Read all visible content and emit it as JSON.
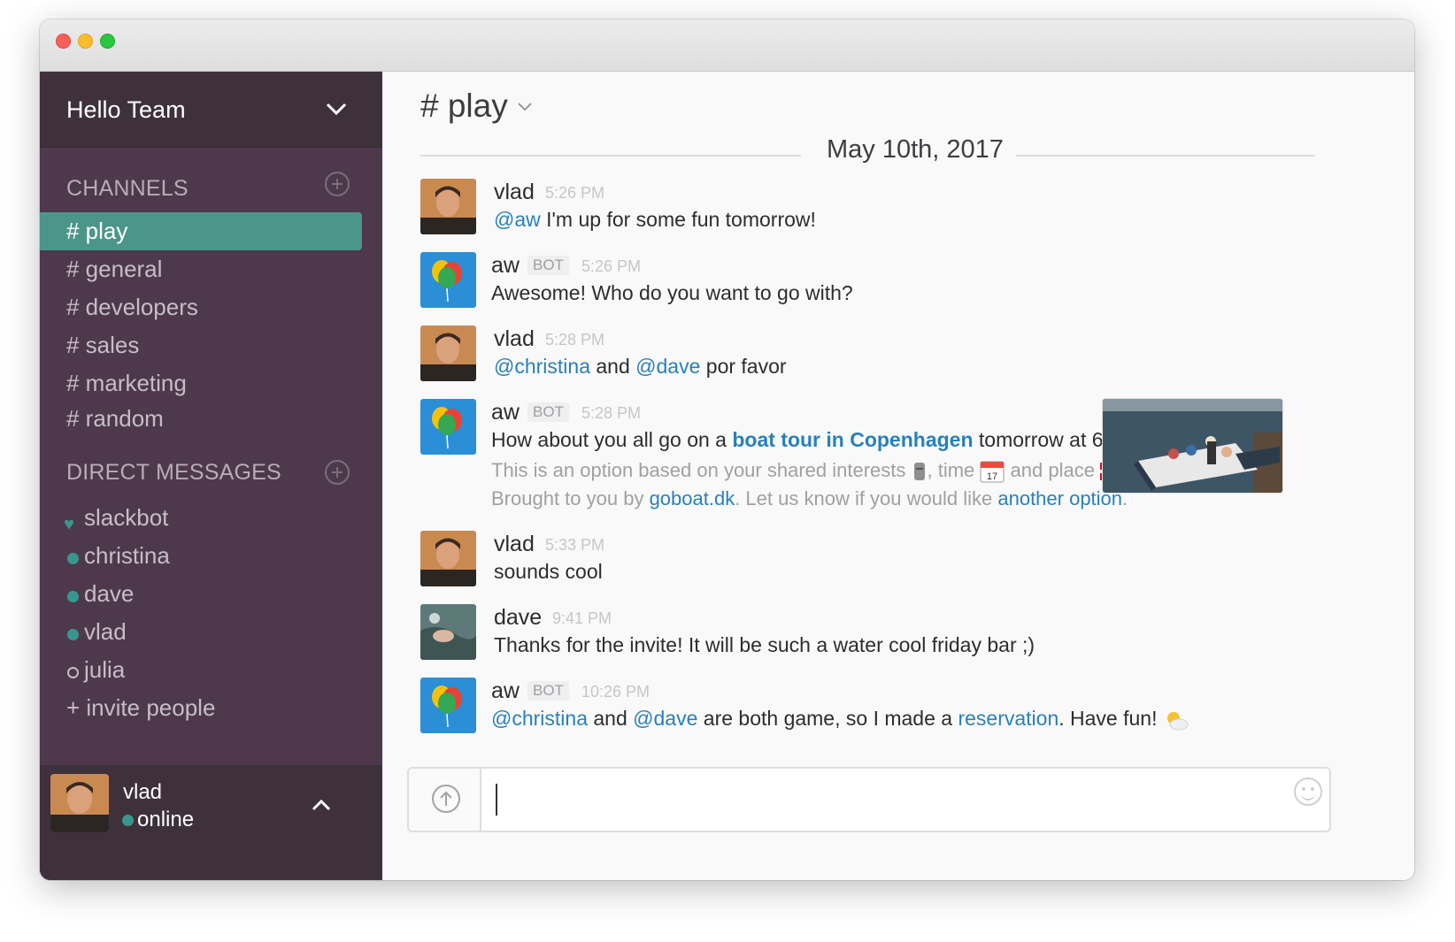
{
  "team": {
    "name": "Hello Team"
  },
  "sidebar": {
    "channels_title": "CHANNELS",
    "channels": [
      {
        "label": "# play",
        "active": true
      },
      {
        "label": "# general"
      },
      {
        "label": "# developers"
      },
      {
        "label": "# sales"
      },
      {
        "label": "# marketing"
      },
      {
        "label": "# random"
      }
    ],
    "dm_title": "DIRECT MESSAGES",
    "dms": [
      {
        "label": "slackbot",
        "presence": "heart"
      },
      {
        "label": "christina",
        "presence": "online"
      },
      {
        "label": "dave",
        "presence": "online"
      },
      {
        "label": "vlad",
        "presence": "online"
      },
      {
        "label": "julia",
        "presence": "away"
      }
    ],
    "invite": "+ invite people"
  },
  "footer_user": {
    "name": "vlad",
    "status": "online"
  },
  "channel": {
    "title": "# play",
    "date": "May 10th, 2017"
  },
  "messages": [
    {
      "author": "vlad",
      "time": "5:26 PM",
      "mention": "@aw",
      "text": " I'm up for some fun tomorrow!"
    },
    {
      "author": "aw",
      "bot": "BOT",
      "time": "5:26 PM",
      "text": "Awesome! Who do you want to go with?"
    },
    {
      "author": "vlad",
      "time": "5:28 PM",
      "mention1": "@christina",
      "mid": " and ",
      "mention2": "@dave",
      "tail": " por favor"
    },
    {
      "author": "aw",
      "bot": "BOT",
      "time": "5:28 PM",
      "pre": "How about you all go on a ",
      "link": "boat tour in Copenhagen",
      "post": " tomorrow at 6 PM?",
      "sub1_a": "This is an option based on your shared interests ",
      "sub1_b": ", time ",
      "sub1_c": " and place ",
      "sub1_d": ".",
      "sub2_a": "Brought to you by ",
      "sub2_link1": "goboat.dk",
      "sub2_b": ". Let us know if you would like ",
      "sub2_link2": "another option",
      "sub2_c": "."
    },
    {
      "author": "vlad",
      "time": "5:33 PM",
      "text": "sounds cool"
    },
    {
      "author": "dave",
      "time": "9:41 PM",
      "text": "Thanks for the invite! It will be such a water cool friday bar ;)"
    },
    {
      "author": "aw",
      "bot": "BOT",
      "time": "10:26 PM",
      "mention1": "@christina",
      "mid": " and ",
      "mention2": "@dave",
      "post": " are both game, so I made a ",
      "link": "reservation",
      "tail": ". Have fun!"
    }
  ],
  "colors": {
    "sidebar": "#4d394b",
    "active_channel": "#4c9689",
    "link": "#2a80b9",
    "presence": "#38978d"
  },
  "icons": [
    "chevron-down-icon",
    "add-circle-icon",
    "heart-icon",
    "chevron-up-icon",
    "upload-icon",
    "emoji-icon"
  ]
}
